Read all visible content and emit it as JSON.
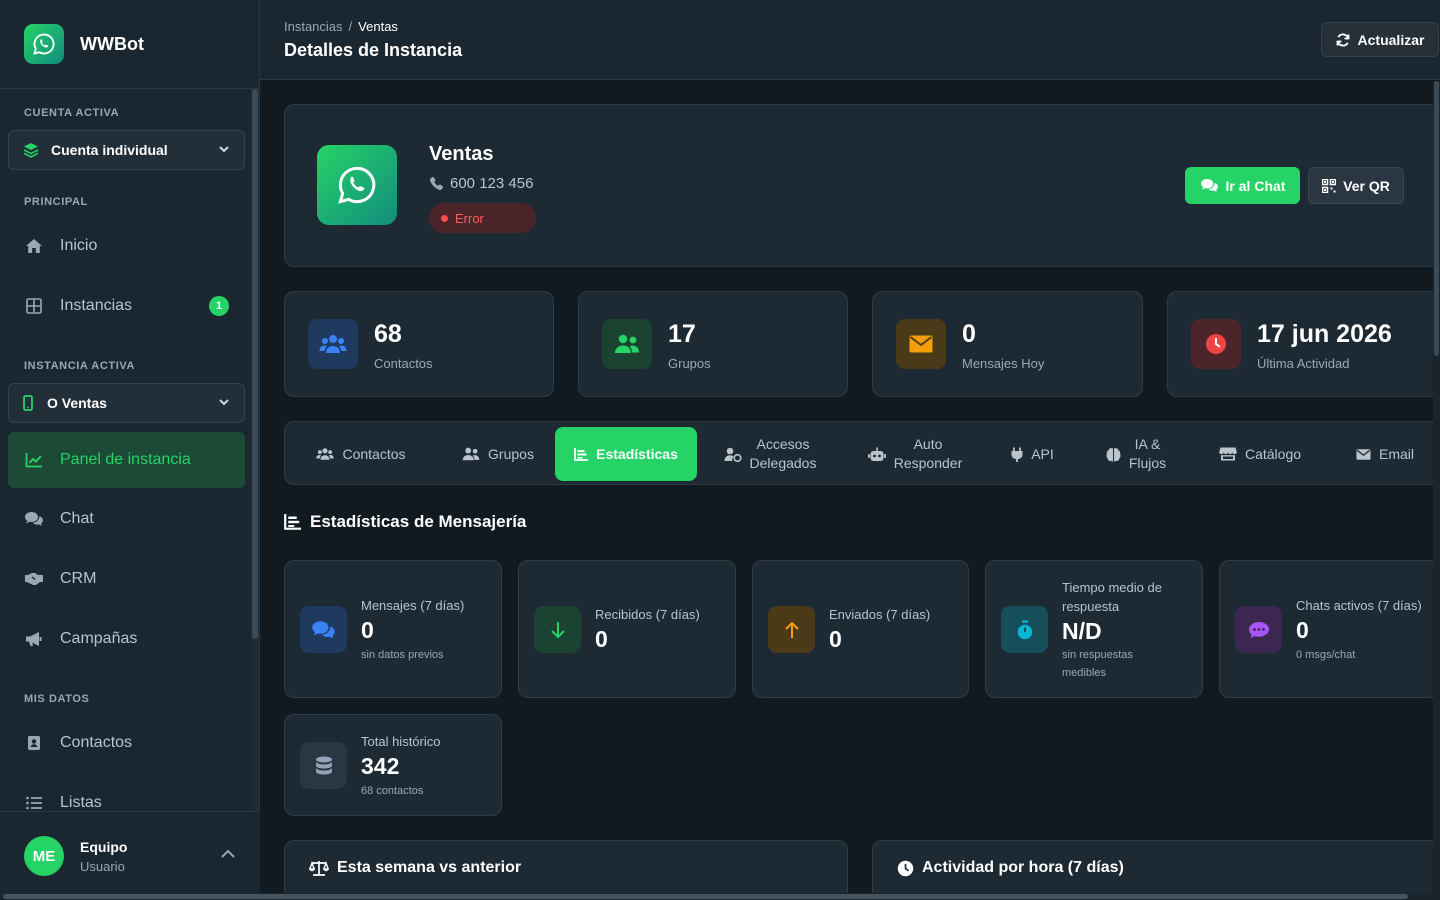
{
  "app": {
    "name": "WWBot"
  },
  "sidebar": {
    "active_account_label": "CUENTA ACTIVA",
    "account_select": "Cuenta individual",
    "principal_label": "PRINCIPAL",
    "items_principal": [
      {
        "label": "Inicio",
        "icon": "home-icon"
      },
      {
        "label": "Instancias",
        "icon": "grid-icon",
        "badge": "1"
      }
    ],
    "active_instance_label": "INSTANCIA ACTIVA",
    "instance_select": "O Ventas",
    "items_instance": [
      {
        "label": "Panel de instancia",
        "icon": "chart-line-icon"
      },
      {
        "label": "Chat",
        "icon": "comments-icon"
      },
      {
        "label": "CRM",
        "icon": "handshake-icon"
      },
      {
        "label": "Campañas",
        "icon": "megaphone-icon"
      }
    ],
    "my_data_label": "MIS DATOS",
    "items_data": [
      {
        "label": "Contactos",
        "icon": "address-book-icon"
      },
      {
        "label": "Listas",
        "icon": "list-icon"
      }
    ],
    "user": {
      "initials": "ME",
      "name": "Equipo",
      "role": "Usuario"
    }
  },
  "header": {
    "breadcrumb": [
      "Instancias",
      "/",
      "Ventas"
    ],
    "title": "Detalles de Instancia",
    "refresh_label": "Actualizar"
  },
  "instance": {
    "name": "Ventas",
    "phone": "600 123 456",
    "status": "Error",
    "chat_button": "Ir al Chat",
    "qr_button": "Ver QR"
  },
  "stats": [
    {
      "value": "68",
      "label": "Contactos",
      "icon": "users-icon",
      "color": "#3b82f6"
    },
    {
      "value": "17",
      "label": "Grupos",
      "icon": "user-group-icon",
      "color": "#25d366"
    },
    {
      "value": "0",
      "label": "Mensajes Hoy",
      "icon": "envelope-icon",
      "color": "#f59e0b"
    },
    {
      "value": "17 jun 2026",
      "label": "Última Actividad",
      "icon": "clock-icon",
      "color": "#ef4444"
    }
  ],
  "tabs": [
    {
      "label": "Contactos",
      "icon": "users-icon"
    },
    {
      "label": "Grupos",
      "icon": "user-group-icon"
    },
    {
      "label": "Estadísticas",
      "icon": "chart-bar-icon"
    },
    {
      "label": "Accesos Delegados",
      "line1": "Accesos",
      "line2": "Delegados",
      "icon": "user-share-icon"
    },
    {
      "label": "Auto Responder",
      "line1": "Auto",
      "line2": "Responder",
      "icon": "robot-icon"
    },
    {
      "label": "API",
      "icon": "plug-icon"
    },
    {
      "label": "IA & Flujos",
      "line1": "IA &",
      "line2": "Flujos",
      "icon": "brain-icon"
    },
    {
      "label": "Catálogo",
      "icon": "store-icon"
    },
    {
      "label": "Email",
      "icon": "envelope-icon"
    }
  ],
  "messaging": {
    "title": "Estadísticas de Mensajería",
    "cards": [
      {
        "label": "Mensajes (7 días)",
        "value": "0",
        "sub": "sin datos previos",
        "icon": "comments-icon",
        "color": "#3b82f6"
      },
      {
        "label": "Recibidos (7 días)",
        "value": "0",
        "icon": "arrow-down-icon",
        "color": "#25d366"
      },
      {
        "label": "Enviados (7 días)",
        "value": "0",
        "icon": "arrow-up-icon",
        "color": "#f59e0b"
      },
      {
        "label_line1": "Tiempo medio de",
        "label_line2": "respuesta",
        "value": "N/D",
        "sub_line1": "sin respuestas",
        "sub_line2": "medibles",
        "icon": "stopwatch-icon",
        "color": "#06b6d4"
      },
      {
        "label": "Chats activos (7 días)",
        "value": "0",
        "sub": "0 msgs/chat",
        "icon": "comment-dots-icon",
        "color": "#a855f7"
      },
      {
        "label": "Total histórico",
        "value": "342",
        "sub": "68 contactos",
        "icon": "database-icon",
        "color": "#94a3b8"
      }
    ]
  },
  "bottom": {
    "left_title": "Esta semana vs anterior",
    "right_title": "Actividad por hora (7 días)"
  }
}
